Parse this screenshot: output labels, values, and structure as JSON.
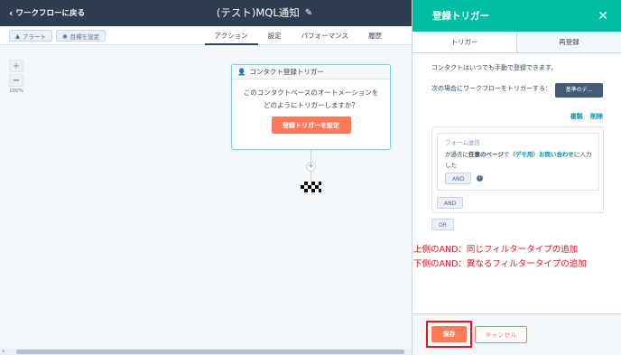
{
  "header": {
    "back_label": "ワークフローに戻る",
    "title": "(テスト)MQL通知"
  },
  "toolbar": {
    "alert_label": "アラート",
    "goal_label": "目標を設定"
  },
  "tabs": [
    {
      "label": "アクション"
    },
    {
      "label": "設定"
    },
    {
      "label": "パフォーマンス"
    },
    {
      "label": "履歴"
    }
  ],
  "canvas": {
    "zoom_in": "+",
    "zoom_out": "−",
    "zoom_level": "100%",
    "trigger_card_title": "コンタクト登録トリガー",
    "trigger_card_text": "このコンタクトベースのオートメーションをどのようにトリガーしますか？",
    "trigger_card_button": "登録トリガーを設定",
    "add_action": "+"
  },
  "panel": {
    "title": "登録トリガー",
    "tabs": [
      {
        "label": "トリガー"
      },
      {
        "label": "再登録"
      }
    ],
    "manual_note": "コンタクトはいつでも手動で登録できます。",
    "trigger_when_label": "次の場合にワークフローをトリガーする：",
    "criteria_button": "基準のデ...",
    "copy_link": "複製",
    "delete_link": "削除",
    "filter_type": "フォーム送信",
    "filter_desc_pre": "が過去に",
    "filter_desc_any": "任意のページ",
    "filter_desc_mid": "で",
    "filter_desc_form": "（デモ用）お問い合わせ",
    "filter_desc_post": "に入力した",
    "and_inner": "AND",
    "and_outer": "AND",
    "or_label": "OR",
    "save_label": "保存",
    "cancel_label": "キャンセル"
  },
  "annotations": {
    "line1": "上側のAND：同じフィルタータイプの追加",
    "line2": "下側のAND：異なるフィルタータイプの追加"
  },
  "colors": {
    "header": "#2d3e50",
    "panel_header": "#00bda5",
    "accent": "#ff7a59",
    "annotation": "#e8141d",
    "link": "#0091ae"
  }
}
